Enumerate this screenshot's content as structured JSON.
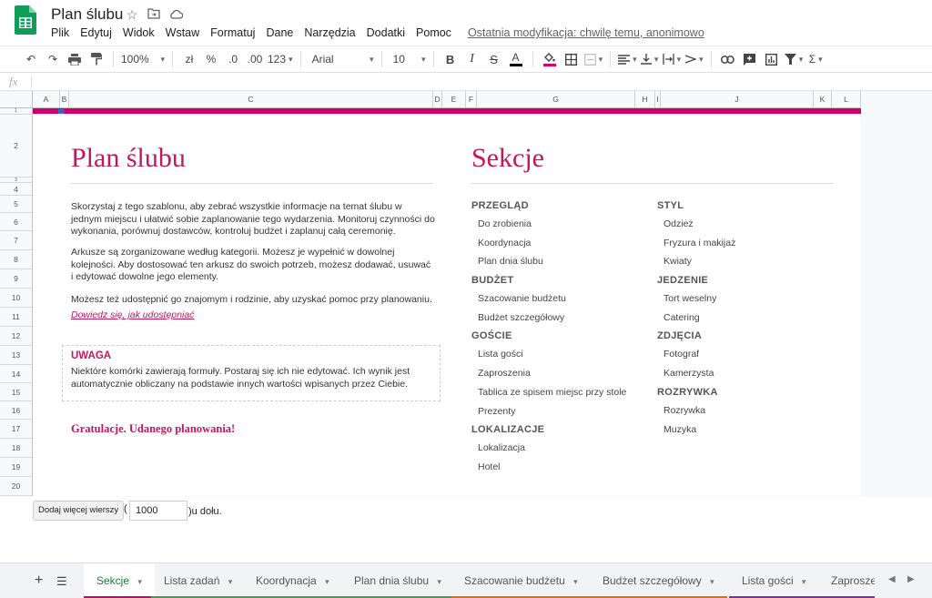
{
  "header": {
    "title": "Plan ślubu",
    "menu": [
      "Plik",
      "Edytuj",
      "Widok",
      "Wstaw",
      "Formatuj",
      "Dane",
      "Narzędzia",
      "Dodatki",
      "Pomoc"
    ],
    "last_edit": "Ostatnia modyfikacja: chwilę temu, anonimowo"
  },
  "toolbar": {
    "zoom": "100%",
    "currency": "zł",
    "percent": "%",
    "dec_less": ".0",
    "dec_more": ".00",
    "number_format": "123",
    "font": "Arial",
    "size": "10",
    "bold": "B",
    "italic": "I",
    "strike": "S",
    "text_color_glyph": "A",
    "text_color": "#000000",
    "fill_color": "#d0006f",
    "sigma": "Σ"
  },
  "formula_bar": {
    "fx": "fx"
  },
  "grid": {
    "columns": [
      "A",
      "B",
      "C",
      "D",
      "E",
      "F",
      "G",
      "H",
      "I",
      "J",
      "K",
      "L"
    ],
    "rows": [
      "1",
      "2",
      "3",
      "4",
      "5",
      "6",
      "7",
      "8",
      "9",
      "10",
      "11",
      "12",
      "13",
      "14",
      "15",
      "16",
      "17",
      "18",
      "19",
      "20"
    ],
    "accent": "#d0006f"
  },
  "content": {
    "main_title": "Plan ślubu",
    "intro_1": "Skorzystaj z tego szablonu, aby zebrać wszystkie informacje na temat ślubu w jednym miejscu i ułatwić sobie zaplanowanie tego wydarzenia. Monitoruj czynności do wykonania, porównuj dostawców, kontroluj budżet i zaplanuj całą ceremonię.",
    "intro_2": "Arkusze są zorganizowane według kategorii. Możesz je wypełnić w dowolnej kolejności. Aby dostosować ten arkusz do swoich potrzeb, możesz dodawać, usuwać i edytować dowolne jego elementy.",
    "intro_3": "Możesz też udostępnić go znajomym i rodzinie, aby uzyskać pomoc przy planowaniu.",
    "share_link": "Dowiedz się, jak udostępniać",
    "warning_title": "UWAGA",
    "warning_text": "Niektóre komórki zawierają formuły. Postaraj się ich nie edytować. Ich wynik jest automatycznie obliczany na podstawie innych wartości wpisanych przez Ciebie.",
    "congrats": "Gratulacje. Udanego planowania!",
    "sections_title": "Sekcje"
  },
  "sections_left": [
    {
      "heading": "PRZEGLĄD",
      "items": [
        "Do zrobienia",
        "Koordynacja",
        "Plan dnia ślubu"
      ]
    },
    {
      "heading": "BUDŻET",
      "items": [
        "Szacowanie budżetu",
        "Budżet szczegółowy"
      ]
    },
    {
      "heading": "GOŚCIE",
      "items": [
        "Lista gości",
        "Zaproszenia",
        "Tablica ze spisem miejsc przy stole",
        "Prezenty"
      ]
    },
    {
      "heading": "LOKALIZACJE",
      "items": [
        "Lokalizacja",
        "Hotel"
      ]
    }
  ],
  "sections_right": [
    {
      "heading": "STYL",
      "items": [
        "Odzież",
        "Fryzura i makijaż",
        "Kwiaty"
      ]
    },
    {
      "heading": "JEDZENIE",
      "items": [
        "Tort weselny",
        "Catering"
      ]
    },
    {
      "heading": "ZDJĘCIA",
      "items": [
        "Fotograf",
        "Kamerzysta"
      ]
    },
    {
      "heading": "ROZRYWKA",
      "items": [
        "Rozrywka",
        "Muzyka"
      ]
    }
  ],
  "add_rows": {
    "button": "Dodaj więcej wierszy",
    "open_paren": "(",
    "value": "1000",
    "suffix": ")u dołu."
  },
  "tabs": [
    {
      "label": "Sekcje",
      "color": "#d0006f",
      "active": true
    },
    {
      "label": "Lista zadań",
      "color": "#43a047"
    },
    {
      "label": "Koordynacja",
      "color": "#43a047"
    },
    {
      "label": "Plan dnia ślubu",
      "color": "#43a047"
    },
    {
      "label": "Szacowanie budżetu",
      "color": "#ef6c00"
    },
    {
      "label": "Budżet szczegółowy",
      "color": "#ef6c00"
    },
    {
      "label": "Lista gości",
      "color": "#8e24aa"
    },
    {
      "label": "Zaprosze",
      "color": "#8e24aa"
    }
  ]
}
